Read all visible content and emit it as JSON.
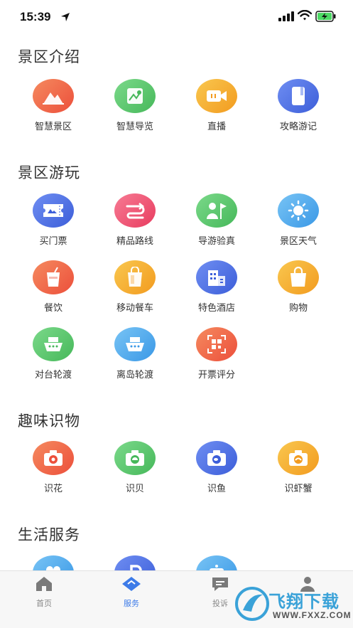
{
  "status_bar": {
    "time": "15:39"
  },
  "sections": [
    {
      "title": "景区介绍",
      "items": [
        {
          "label": "智慧景区",
          "icon": "mountain-picture-icon",
          "color": "#f0694a"
        },
        {
          "label": "智慧导览",
          "icon": "map-icon",
          "color": "#5fc96e"
        },
        {
          "label": "直播",
          "icon": "video-camera-icon",
          "color": "#f7b233"
        },
        {
          "label": "攻略游记",
          "icon": "notebook-icon",
          "color": "#4c72e6"
        }
      ]
    },
    {
      "title": "景区游玩",
      "items": [
        {
          "label": "买门票",
          "icon": "ticket-icon",
          "color": "#4c72e6"
        },
        {
          "label": "精品路线",
          "icon": "route-icon",
          "color": "#ef4d6c"
        },
        {
          "label": "导游验真",
          "icon": "guide-flag-icon",
          "color": "#5fc96e"
        },
        {
          "label": "景区天气",
          "icon": "sun-icon",
          "color": "#4ca9ef"
        },
        {
          "label": "餐饮",
          "icon": "drink-cup-icon",
          "color": "#f0694a"
        },
        {
          "label": "移动餐车",
          "icon": "food-bag-icon",
          "color": "#f7b233"
        },
        {
          "label": "特色酒店",
          "icon": "hotel-building-icon",
          "color": "#4c72e6"
        },
        {
          "label": "购物",
          "icon": "shopping-bag-icon",
          "color": "#f7b233"
        },
        {
          "label": "对台轮渡",
          "icon": "ferry-ship-icon",
          "color": "#5fc96e"
        },
        {
          "label": "离岛轮渡",
          "icon": "island-ship-icon",
          "color": "#4ca9ef"
        },
        {
          "label": "开票评分",
          "icon": "qr-code-icon",
          "color": "#f0694a"
        }
      ]
    },
    {
      "title": "趣味识物",
      "items": [
        {
          "label": "识花",
          "icon": "camera-flower-icon",
          "color": "#f0694a"
        },
        {
          "label": "识贝",
          "icon": "camera-shell-icon",
          "color": "#5fc96e"
        },
        {
          "label": "识鱼",
          "icon": "camera-fish-icon",
          "color": "#4c72e6"
        },
        {
          "label": "识虾蟹",
          "icon": "camera-crab-icon",
          "color": "#f7b233"
        }
      ]
    },
    {
      "title": "生活服务",
      "items": [
        {
          "label": "",
          "icon": "people-icon",
          "color": "#4ca9ef"
        },
        {
          "label": "",
          "icon": "parking-icon",
          "color": "#4c72e6"
        },
        {
          "label": "",
          "icon": "bus-icon",
          "color": "#4ca9ef"
        }
      ]
    }
  ],
  "tabbar": {
    "items": [
      {
        "label": "首页",
        "icon": "home-icon",
        "active": false
      },
      {
        "label": "服务",
        "icon": "service-diamond-icon",
        "active": true
      },
      {
        "label": "投诉",
        "icon": "chat-bubble-icon",
        "active": false
      },
      {
        "label": "",
        "icon": "person-icon",
        "active": false
      }
    ]
  },
  "watermark": {
    "text": "飞翔下载",
    "url": "WWW.FXXZ.COM"
  }
}
